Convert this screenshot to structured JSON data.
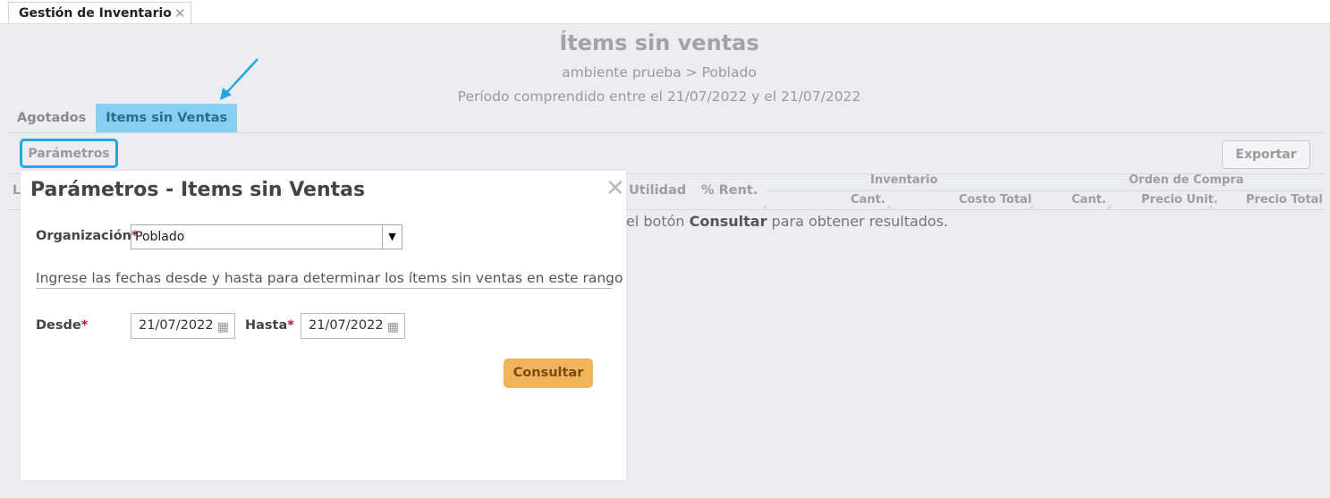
{
  "app": {
    "doc_tab": "Gestión de Inventario",
    "doc_tab_close": "✕"
  },
  "report": {
    "title": "Ítems sin ventas",
    "breadcrumb": "ambiente prueba > Poblado",
    "period": "Período comprendido entre el 21/07/2022 y el 21/07/2022"
  },
  "tabs": [
    {
      "label": "Agotados",
      "active": false
    },
    {
      "label": "Items sin Ventas",
      "active": true
    }
  ],
  "toolbar": {
    "params_label": "Parámetros",
    "export_label": "Exportar"
  },
  "table": {
    "col_first_partial": "L",
    "col_utilidad": "Utilidad",
    "col_rent": "% Rent.",
    "group_inventario": "Inventario",
    "group_orden": "Orden de Compra",
    "sub_cant": "Cant.",
    "sub_costo_total": "Costo Total",
    "sub_cant2": "Cant.",
    "sub_precio_unit": "Precio Unit.",
    "sub_precio_total": "Precio Total",
    "hint_pre": "el botón ",
    "hint_bold": "Consultar",
    "hint_post": " para obtener resultados."
  },
  "modal": {
    "title": "Parámetros - Items sin Ventas",
    "close": "✕",
    "org_label": "Organización",
    "required_mark": "*",
    "org_value": "Poblado",
    "info": "Ingrese las fechas desde y hasta para determinar los ítems sin ventas en este rango",
    "desde_label": "Desde",
    "desde_value": "21/07/2022",
    "hasta_label": "Hasta",
    "hasta_value": "21/07/2022",
    "consultar_label": "Consultar"
  },
  "colors": {
    "active_tab": "#84d0f2",
    "highlight": "#1fa9de",
    "consultar": "#f0b45a",
    "required": "#b5173b"
  },
  "icons": {
    "tab_close": "close-icon",
    "dropdown": "chevron-down-icon",
    "calendar": "calendar-icon",
    "arrow": "annotation-arrow-icon"
  }
}
